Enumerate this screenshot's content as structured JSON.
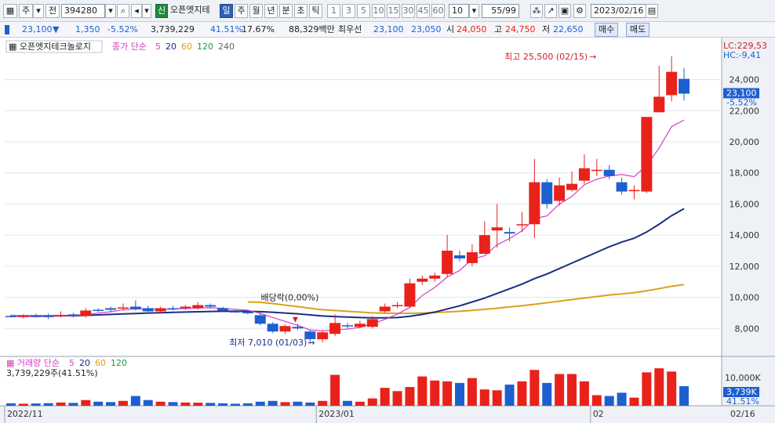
{
  "toolbar": {
    "stock_code": "394280",
    "stock_name": "오픈엣지테",
    "type_button": "주",
    "prev_button": "전",
    "credit_badge": "신",
    "periods": [
      "일",
      "주",
      "월",
      "년",
      "분",
      "초",
      "틱"
    ],
    "active_period": "일",
    "intervals": [
      "1",
      "3",
      "5",
      "10",
      "15",
      "30",
      "45",
      "60"
    ],
    "interval_select": "10",
    "count": "55/99",
    "date": "2023/02/16"
  },
  "quote": {
    "price": "23,100",
    "change": "1,350",
    "change_pct": "-5.52%",
    "volume": "3,739,229",
    "vol_ratio": "41.51%",
    "turnover": "17.67%",
    "amount": "88,329백만",
    "priority_label": "최우선",
    "bid": "23,100",
    "ask": "23,050",
    "open_label": "시",
    "open": "24,050",
    "high_label": "고",
    "high": "24,750",
    "low_label": "저",
    "low": "22,650",
    "buy_button": "매수",
    "sell_button": "매도"
  },
  "colors": {
    "up": "#e8221a",
    "down": "#1e5fd0",
    "ma5": "#d23fbf",
    "ma20": "#1a2e84",
    "ma60": "#d8a21a",
    "ma120": "#1c9a3c"
  },
  "chart_data": {
    "type": "candlestick",
    "legend": {
      "name": "오픈엣지테크놀로지",
      "ma_label": "종가 단순",
      "periods": [
        "5",
        "20",
        "60",
        "120",
        "240"
      ]
    },
    "y_ticks": [
      "24,000",
      "22,000",
      "20,000",
      "18,000",
      "16,000",
      "14,000",
      "12,000",
      "10,000",
      "8,000"
    ],
    "y_tick_values": [
      24000,
      22000,
      20000,
      18000,
      16000,
      14000,
      12000,
      10000,
      8000
    ],
    "ylim": [
      6300,
      26400
    ],
    "x_labels": [
      "2022/11",
      "2023/01",
      "02",
      "02/16"
    ],
    "x_label_index": [
      0,
      25,
      47,
      62
    ],
    "lc_label": "LC:229,53",
    "hc_label": "HC:-9,41",
    "price_box": "23,100",
    "price_pct": "-5.52%",
    "annotation_high": "최고 25,500 (02/15)",
    "annotation_low": "최저 7,010 (01/03)",
    "annotation_div": "배당락(0,00%)",
    "candles": [
      {
        "o": 8800,
        "c": 8780,
        "h": 8900,
        "l": 8700
      },
      {
        "o": 8750,
        "c": 8800,
        "h": 8900,
        "l": 8650
      },
      {
        "o": 8800,
        "c": 8780,
        "h": 8950,
        "l": 8700
      },
      {
        "o": 8800,
        "c": 8760,
        "h": 8950,
        "l": 8600
      },
      {
        "o": 8850,
        "c": 8870,
        "h": 9100,
        "l": 8700
      },
      {
        "o": 8900,
        "c": 8850,
        "h": 9000,
        "l": 8700
      },
      {
        "o": 8800,
        "c": 9150,
        "h": 9300,
        "l": 8700
      },
      {
        "o": 9200,
        "c": 9150,
        "h": 9300,
        "l": 9050
      },
      {
        "o": 9300,
        "c": 9200,
        "h": 9400,
        "l": 9050
      },
      {
        "o": 9300,
        "c": 9350,
        "h": 9600,
        "l": 9150
      },
      {
        "o": 9400,
        "c": 9250,
        "h": 9800,
        "l": 9150
      },
      {
        "o": 9300,
        "c": 9100,
        "h": 9450,
        "l": 9000
      },
      {
        "o": 9100,
        "c": 9300,
        "h": 9400,
        "l": 9000
      },
      {
        "o": 9300,
        "c": 9250,
        "h": 9450,
        "l": 9150
      },
      {
        "o": 9300,
        "c": 9400,
        "h": 9500,
        "l": 9200
      },
      {
        "o": 9300,
        "c": 9500,
        "h": 9700,
        "l": 9200
      },
      {
        "o": 9500,
        "c": 9400,
        "h": 9600,
        "l": 9300
      },
      {
        "o": 9300,
        "c": 9150,
        "h": 9400,
        "l": 9100
      },
      {
        "o": 9100,
        "c": 9050,
        "h": 9200,
        "l": 9000
      },
      {
        "o": 9050,
        "c": 9000,
        "h": 9150,
        "l": 8900
      },
      {
        "o": 8850,
        "c": 8300,
        "h": 8950,
        "l": 8200
      },
      {
        "o": 8300,
        "c": 7800,
        "h": 8400,
        "l": 7700
      },
      {
        "o": 7800,
        "c": 8150,
        "h": 8250,
        "l": 7650
      },
      {
        "o": 8100,
        "c": 8000,
        "h": 8300,
        "l": 7900
      },
      {
        "o": 7800,
        "c": 7310,
        "h": 7900,
        "l": 7010
      },
      {
        "o": 7300,
        "c": 7750,
        "h": 7850,
        "l": 7100
      },
      {
        "o": 7650,
        "c": 8350,
        "h": 8900,
        "l": 7500
      },
      {
        "o": 8200,
        "c": 8150,
        "h": 8350,
        "l": 8000
      },
      {
        "o": 8100,
        "c": 8300,
        "h": 8500,
        "l": 8000
      },
      {
        "o": 8100,
        "c": 8600,
        "h": 8800,
        "l": 8000
      },
      {
        "o": 9100,
        "c": 9400,
        "h": 9600,
        "l": 9000
      },
      {
        "o": 9500,
        "c": 9500,
        "h": 9700,
        "l": 9300
      },
      {
        "o": 9400,
        "c": 10900,
        "h": 11200,
        "l": 9300
      },
      {
        "o": 11000,
        "c": 11200,
        "h": 11400,
        "l": 10800
      },
      {
        "o": 11200,
        "c": 11400,
        "h": 11600,
        "l": 11000
      },
      {
        "o": 11500,
        "c": 13000,
        "h": 14000,
        "l": 11300
      },
      {
        "o": 12700,
        "c": 12500,
        "h": 13000,
        "l": 12300
      },
      {
        "o": 12200,
        "c": 12900,
        "h": 13400,
        "l": 12000
      },
      {
        "o": 12800,
        "c": 14000,
        "h": 14900,
        "l": 12800
      },
      {
        "o": 14300,
        "c": 14500,
        "h": 16000,
        "l": 13200
      },
      {
        "o": 14200,
        "c": 14100,
        "h": 14500,
        "l": 13600
      },
      {
        "o": 14700,
        "c": 14700,
        "h": 15500,
        "l": 14200
      },
      {
        "o": 14700,
        "c": 17400,
        "h": 18900,
        "l": 13800
      },
      {
        "o": 17400,
        "c": 16000,
        "h": 17600,
        "l": 15700
      },
      {
        "o": 16200,
        "c": 17200,
        "h": 17700,
        "l": 15900
      },
      {
        "o": 16900,
        "c": 17300,
        "h": 18100,
        "l": 16800
      },
      {
        "o": 17500,
        "c": 18300,
        "h": 19200,
        "l": 17300
      },
      {
        "o": 18200,
        "c": 18200,
        "h": 18900,
        "l": 17800
      },
      {
        "o": 18200,
        "c": 17800,
        "h": 18500,
        "l": 17600
      },
      {
        "o": 17400,
        "c": 16800,
        "h": 17700,
        "l": 16600
      },
      {
        "o": 16900,
        "c": 16900,
        "h": 17200,
        "l": 16300
      },
      {
        "o": 16800,
        "c": 21600,
        "h": 21600,
        "l": 16700
      },
      {
        "o": 21900,
        "c": 22900,
        "h": 24900,
        "l": 22000
      },
      {
        "o": 23000,
        "c": 24500,
        "h": 25500,
        "l": 22600
      },
      {
        "o": 24050,
        "c": 23100,
        "h": 24750,
        "l": 22650
      }
    ],
    "ma5": [
      8780,
      8790,
      8785,
      8780,
      8795,
      8830,
      8875,
      8985,
      9070,
      9200,
      9250,
      9250,
      9230,
      9240,
      9280,
      9310,
      9330,
      9290,
      9230,
      9170,
      8970,
      8700,
      8450,
      8200,
      7900,
      7850,
      7890,
      7960,
      8070,
      8300,
      8580,
      8920,
      9350,
      10120,
      10640,
      11300,
      11730,
      12460,
      12670,
      13380,
      13780,
      14270,
      15060,
      15240,
      16000,
      16480,
      17240,
      17600,
      17800,
      17900,
      17760,
      18480,
      19600,
      20980,
      21400
    ],
    "ma20": [
      8800,
      8800,
      8800,
      8800,
      8810,
      8820,
      8840,
      8870,
      8900,
      8930,
      8960,
      8990,
      9010,
      9030,
      9050,
      9070,
      9090,
      9100,
      9110,
      9100,
      9080,
      9040,
      8990,
      8940,
      8870,
      8800,
      8760,
      8730,
      8700,
      8680,
      8680,
      8700,
      8780,
      8900,
      9050,
      9250,
      9450,
      9700,
      9950,
      10250,
      10550,
      10850,
      11200,
      11500,
      11850,
      12200,
      12550,
      12900,
      13250,
      13550,
      13800,
      14200,
      14700,
      15250,
      15700
    ],
    "ma60": [
      null,
      null,
      null,
      null,
      null,
      null,
      null,
      null,
      null,
      null,
      null,
      null,
      null,
      null,
      null,
      null,
      null,
      null,
      null,
      9700,
      9680,
      9600,
      9500,
      9400,
      9300,
      9200,
      9150,
      9100,
      9050,
      9000,
      8980,
      8970,
      8970,
      8990,
      9020,
      9060,
      9100,
      9160,
      9230,
      9300,
      9380,
      9460,
      9550,
      9650,
      9750,
      9850,
      9950,
      10050,
      10150,
      10220,
      10300,
      10420,
      10560,
      10710,
      10820
    ],
    "volume_legend": {
      "label": "거래량 단순",
      "periods": [
        "5",
        "20",
        "60",
        "120"
      ]
    },
    "volume_text": "3,739,229주(41.51%)",
    "volume_ticks": [
      "10,000K"
    ],
    "volume_box": "3,739K",
    "volume_pct": "41.51%",
    "volumes": [
      300,
      250,
      280,
      320,
      400,
      350,
      700,
      500,
      450,
      600,
      1200,
      700,
      500,
      450,
      400,
      380,
      350,
      300,
      250,
      300,
      500,
      600,
      450,
      500,
      400,
      600,
      3800,
      600,
      500,
      900,
      2200,
      1800,
      2300,
      3600,
      3100,
      3000,
      2800,
      3400,
      2000,
      1900,
      2600,
      3000,
      4400,
      2800,
      3900,
      3900,
      3000,
      1300,
      1200,
      1600,
      1000,
      4100,
      4600,
      4200,
      2400
    ],
    "volume_max": 5000
  }
}
